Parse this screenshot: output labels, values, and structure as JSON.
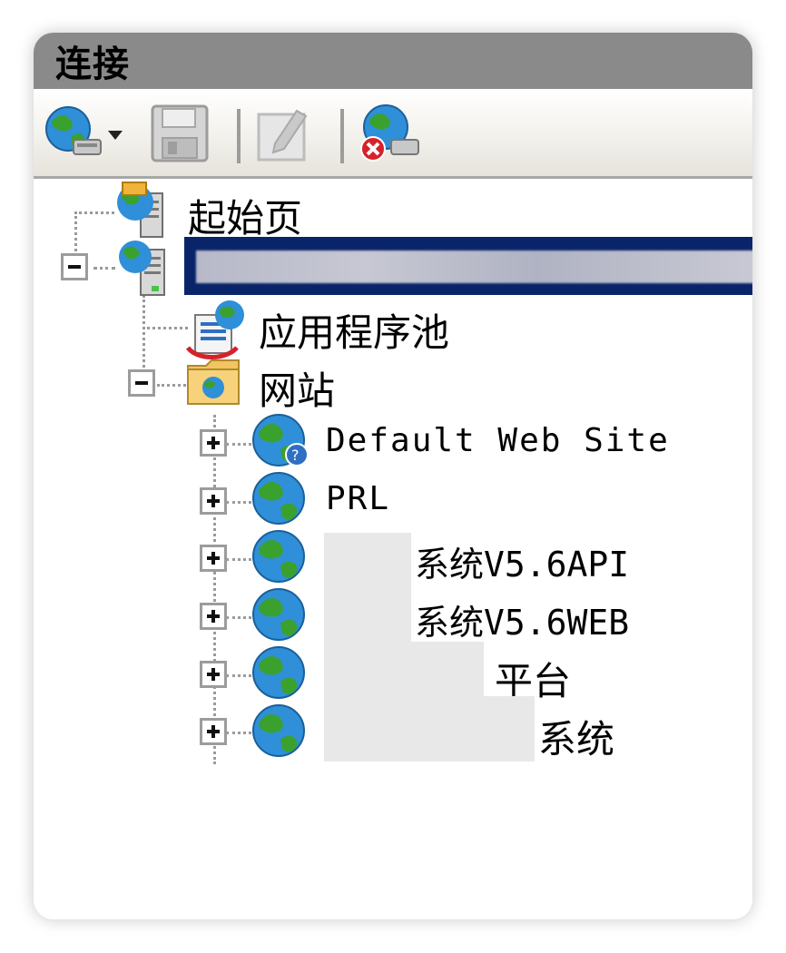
{
  "panel": {
    "title": "连接"
  },
  "toolbar": {
    "items": [
      {
        "name": "connect-globe-icon"
      },
      {
        "name": "dropdown-arrow-icon"
      },
      {
        "name": "save-icon"
      },
      {
        "name": "separator"
      },
      {
        "name": "edit-icon"
      },
      {
        "name": "separator"
      },
      {
        "name": "disconnect-icon"
      }
    ]
  },
  "tree": {
    "start_page": "起始页",
    "server_name": "",
    "app_pools": "应用程序池",
    "sites": "网站",
    "site_items": [
      "Default Web Site",
      "PRL",
      "系统V5.6API",
      "系统V5.6WEB",
      "平台",
      "系统"
    ]
  },
  "colors": {
    "titlebar": "#8a8a8a",
    "selection": "#0a246a",
    "tree_lines": "#9a9a9a"
  }
}
